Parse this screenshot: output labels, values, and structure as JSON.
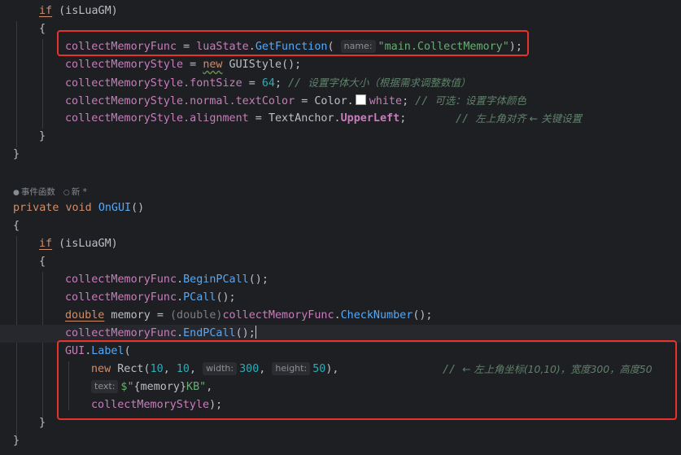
{
  "code": {
    "block1": {
      "if_kw": "if",
      "if_cond": " (isLuaGM)",
      "open_brace": "{",
      "l_collect_func_name": "collectMemoryFunc",
      "l_collect_eq": " = ",
      "l_luastate": "luaState",
      "l_dot": ".",
      "l_getfunction": "GetFunction",
      "l_paren_open": "(",
      "hint_name": "name:",
      "str_main_collect": "\"main.CollectMemory\"",
      "l_paren_close_semi": ");",
      "l_style_name": "collectMemoryStyle",
      "l_eq": " = ",
      "l_new": "new",
      "l_guistyle": " GUIStyle",
      "l_guistyle_tail": "();",
      "l_fontsize_obj": "collectMemoryStyle",
      "l_fontsize_field": ".fontSize",
      "l_fontsize_eq": " = ",
      "l_fontsize_val": "64",
      "l_fontsize_semi": "; ",
      "l_fontsize_comment_slash": "// ",
      "l_fontsize_comment": "设置字体大小（根据需求调整数值）",
      "l_textcolor_obj": "collectMemoryStyle",
      "l_textcolor_field1": ".normal",
      "l_textcolor_field2": ".textColor",
      "l_textcolor_eq": " = ",
      "l_color_type": "Color.",
      "l_color_white": "white",
      "l_textcolor_semi": "; ",
      "l_textcolor_comment_slash": "// ",
      "l_textcolor_comment": "可选：设置字体颜色",
      "l_align_obj": "collectMemoryStyle",
      "l_align_field": ".alignment",
      "l_align_eq": " = ",
      "l_align_type": "TextAnchor.",
      "l_align_val": "UpperLeft",
      "l_align_semi": ";",
      "l_align_comment_slash": "// ",
      "l_align_comment": "左上角对齐 ← 关键设置",
      "close_brace_inner": "}",
      "close_brace_outer": "}"
    },
    "codelens": {
      "events": "事件函数",
      "new": "新 *"
    },
    "ongui": {
      "private_kw": "private",
      "void_kw": " void ",
      "fn_name": "OnGUI",
      "parens": "()",
      "open_brace": "{",
      "if_kw": "if",
      "if_cond": " (isLuaGM)",
      "inner_open_brace": "{",
      "l1_obj": "collectMemoryFunc",
      "l1_method": "BeginPCall",
      "l1_tail": "();",
      "l2_obj": "collectMemoryFunc",
      "l2_method": "PCall",
      "l2_tail": "();",
      "l3_double": "double",
      "l3_memory": " memory ",
      "l3_eq": "= ",
      "l3_cast": "(double)",
      "l3_obj": "collectMemoryFunc",
      "l3_method": "CheckNumber",
      "l3_tail": "();",
      "l4_obj": "collectMemoryFunc",
      "l4_method": "EndPCall",
      "l4_tail": "();",
      "l5_gui": "GUI",
      "l5_label": "Label",
      "l5_paren": "(",
      "l6_new": "new",
      "l6_rect": " Rect",
      "l6_paren": "(",
      "l6_x": "10",
      "l6_comma1": ", ",
      "l6_y": "10",
      "l6_comma2": ", ",
      "hint_width": "width:",
      "l6_w": "300",
      "l6_comma3": ", ",
      "hint_height": "height:",
      "l6_h": "50",
      "l6_close": "),",
      "l6_comment_slash": "// ",
      "l6_comment": "← 左上角坐标(10,10)，宽度300，高度50",
      "hint_text": "text:",
      "l7_dollar": "$\"",
      "l7_interp": "{memory}",
      "l7_kb": "KB\"",
      "l7_comma": ",",
      "l8_style": "collectMemoryStyle",
      "l8_tail": ");",
      "inner_close_brace": "}",
      "close_brace": "}"
    }
  },
  "colors": {
    "background": "#1e1f22",
    "highlight_box": "#e8322b"
  }
}
